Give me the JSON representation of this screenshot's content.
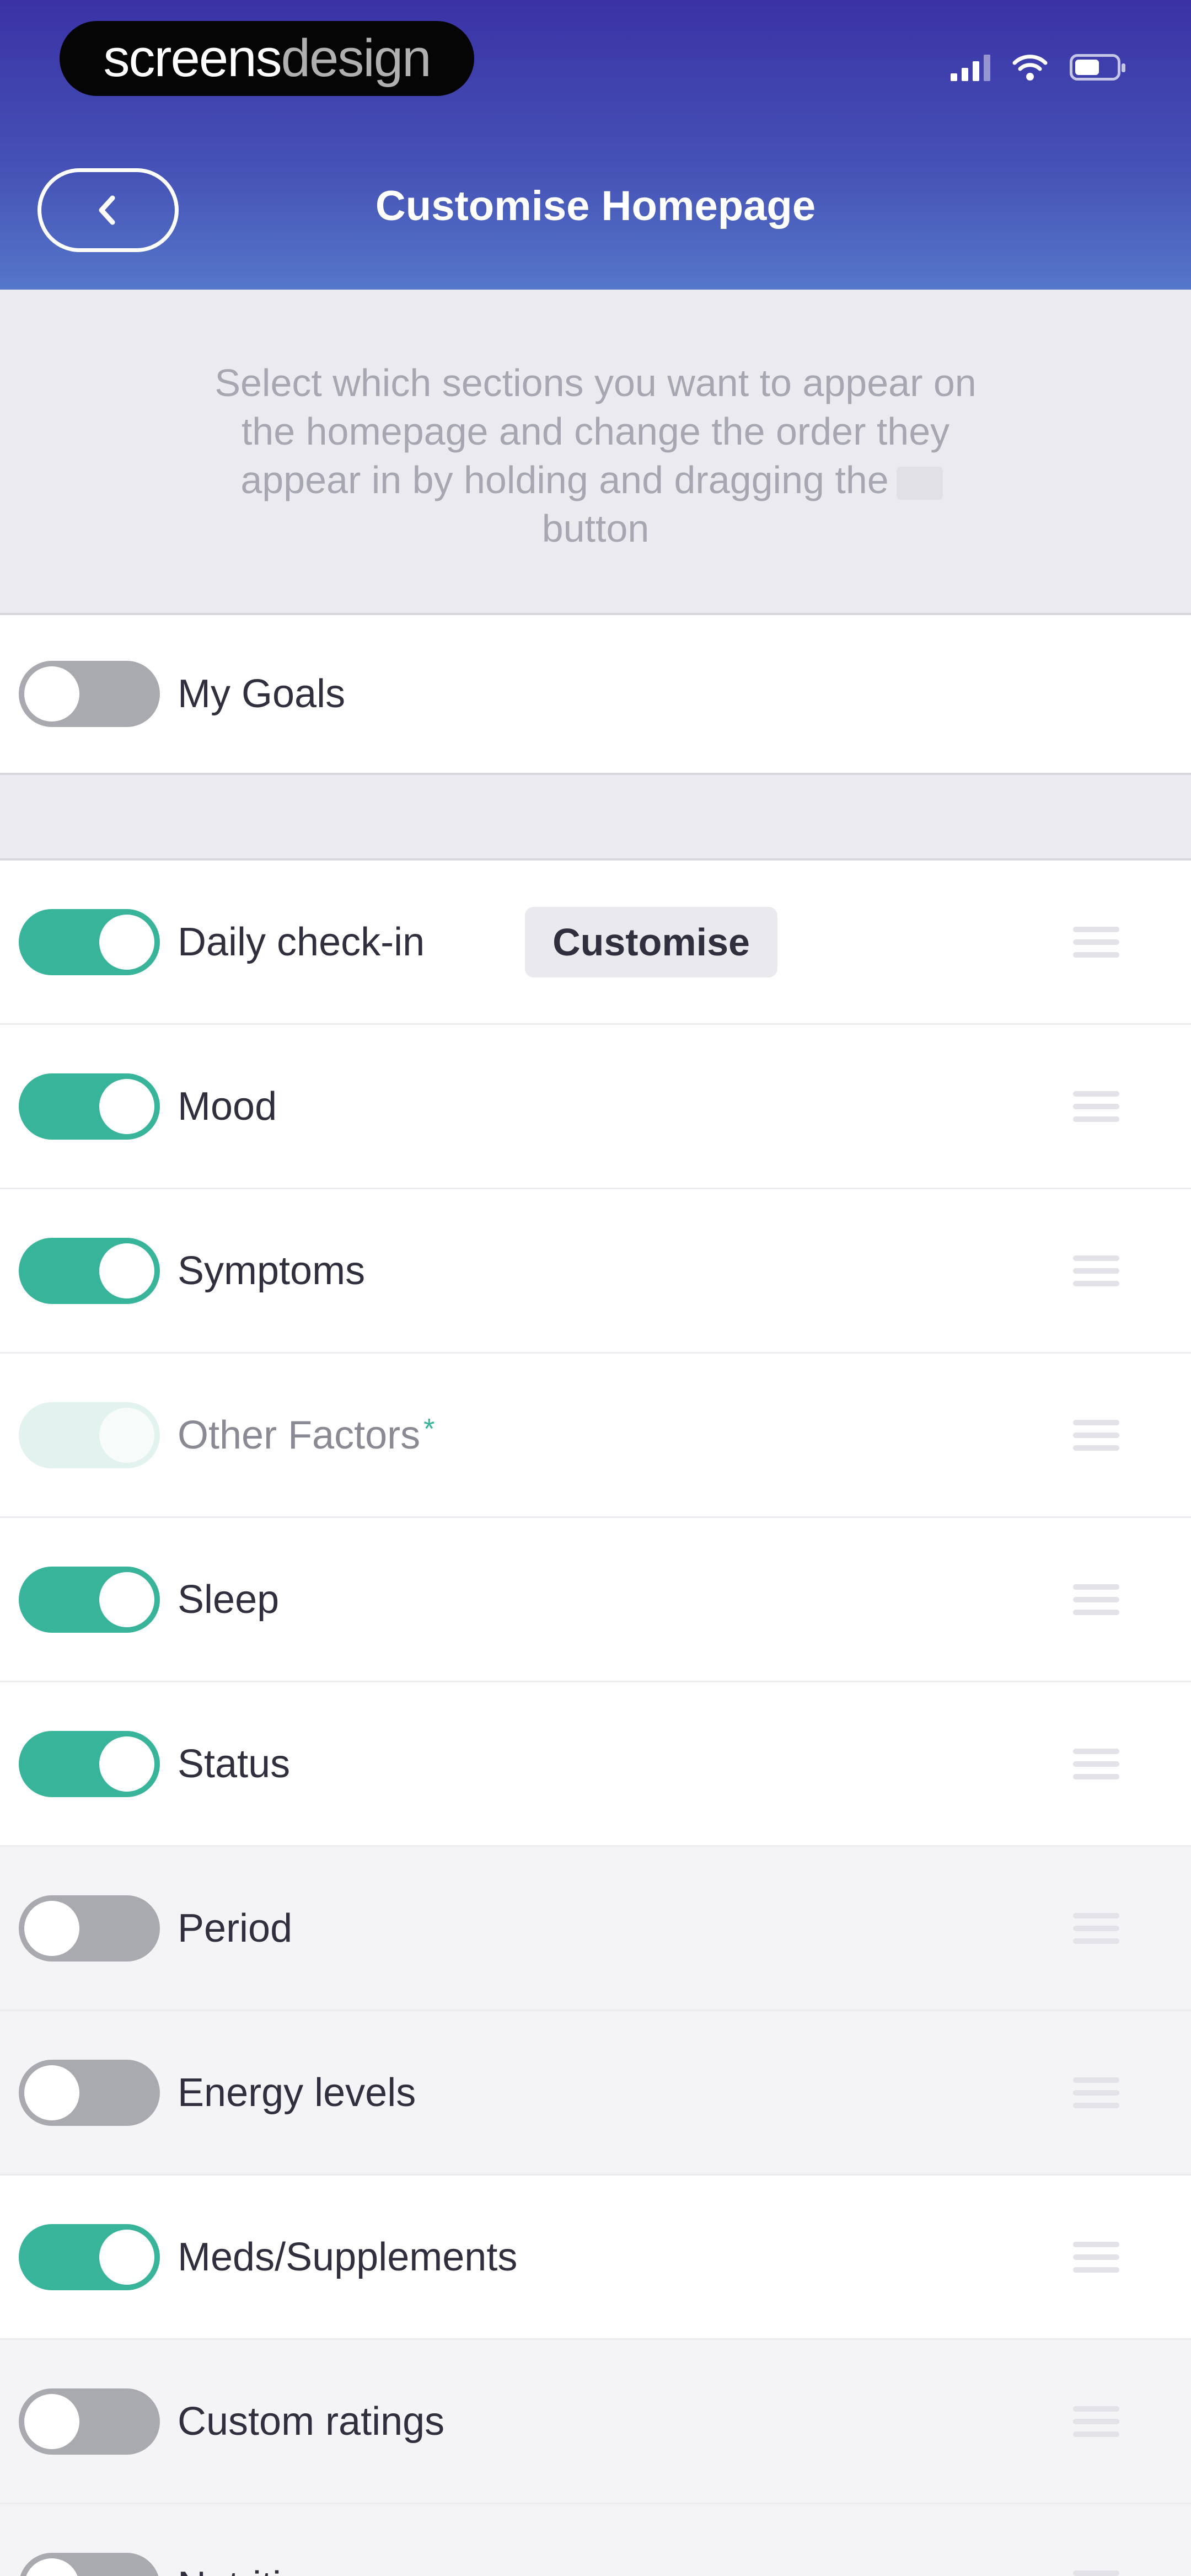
{
  "status_bar": {
    "watermark": "screensdesign",
    "watermark_bold": "screens",
    "watermark_light": "design",
    "icons": [
      "signal-icon",
      "wifi-icon",
      "battery-icon"
    ],
    "battery_level": 0.6
  },
  "header": {
    "title": "Customise Homepage",
    "back_icon": "chevron-left-icon",
    "gradient_colors": [
      "#3a32a6",
      "#5577c9"
    ]
  },
  "instructions": {
    "text_before": "Select which sections you want to appear on the homepage and change the order they appear in by holding and dragging the",
    "text_after": "button"
  },
  "goals": {
    "label": "My Goals",
    "enabled": false
  },
  "sections": [
    {
      "label": "Daily check-in",
      "enabled": true,
      "action_label": "Customise"
    },
    {
      "label": "Mood",
      "enabled": true
    },
    {
      "label": "Symptoms",
      "enabled": true
    },
    {
      "label": "Other Factors",
      "enabled": true,
      "disabled": true,
      "asterisk": "*"
    },
    {
      "label": "Sleep",
      "enabled": true
    },
    {
      "label": "Status",
      "enabled": true
    },
    {
      "label": "Period",
      "enabled": false
    },
    {
      "label": "Energy levels",
      "enabled": false
    },
    {
      "label": "Meds/Supplements",
      "enabled": true
    },
    {
      "label": "Custom ratings",
      "enabled": false
    },
    {
      "label": "Nutrition",
      "enabled": false
    }
  ],
  "colors": {
    "toggle_on": "#38b49a",
    "toggle_off": "#a9a9b0",
    "text_primary": "#2f2f3e",
    "instructions_text": "#a7a7b2"
  }
}
